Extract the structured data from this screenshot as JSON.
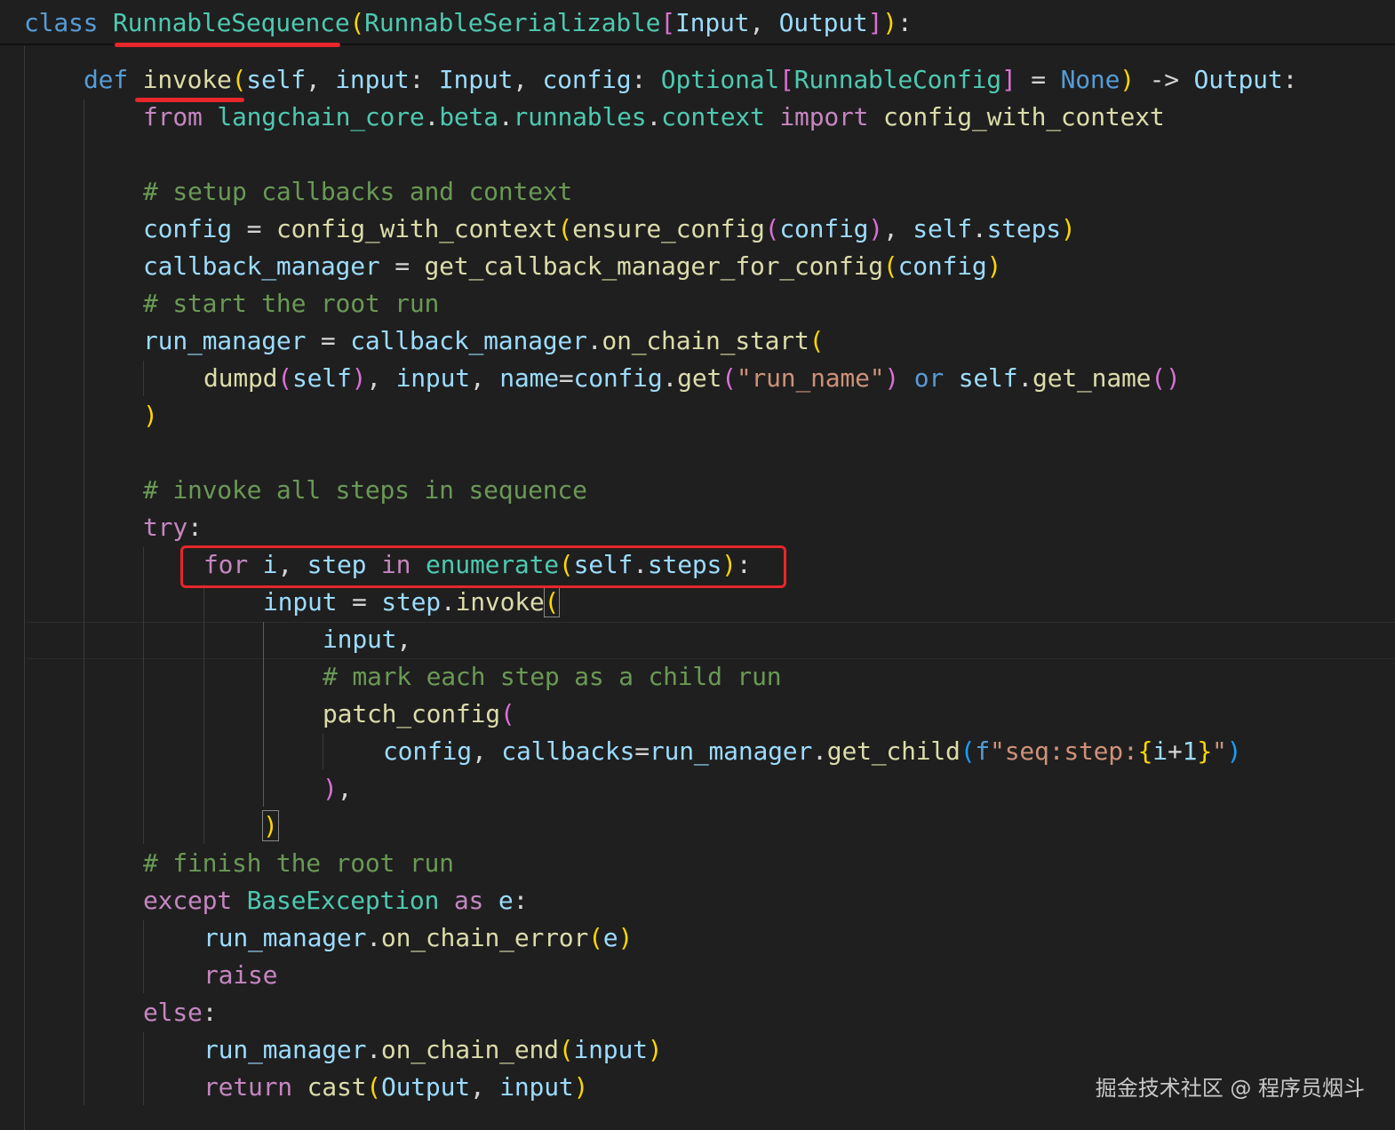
{
  "code": {
    "l1": {
      "a": "class",
      "b": "RunnableSequence",
      "c": "(",
      "d": "RunnableSerializable",
      "e": "[",
      "f": "Input",
      "g": ", ",
      "h": "Output",
      "i": "]",
      "j": ")",
      "k": ":"
    },
    "l2": {
      "a": "def",
      "b": "invoke",
      "c": "(",
      "d": "self",
      "e": ", ",
      "f": "input",
      "g": ": ",
      "h": "Input",
      "i": ", ",
      "j": "config",
      "k": ": ",
      "l": "Optional",
      "m": "[",
      "n": "RunnableConfig",
      "o": "]",
      "p": " = ",
      "q": "None",
      "r": ")",
      "s": " -> ",
      "t": "Output",
      "u": ":"
    },
    "l3": {
      "a": "from",
      "b": "langchain_core",
      "c": ".",
      "d": "beta",
      "e": ".",
      "f": "runnables",
      "g": ".",
      "h": "context",
      "i": "import",
      "j": "config_with_context"
    },
    "l4": {
      "a": "# setup callbacks and context"
    },
    "l5": {
      "a": "config",
      "b": " = ",
      "c": "config_with_context",
      "d": "(",
      "e": "ensure_config",
      "f": "(",
      "g": "config",
      "h": ")",
      "i": ", ",
      "j": "self",
      "k": ".",
      "l": "steps",
      "m": ")"
    },
    "l6": {
      "a": "callback_manager",
      "b": " = ",
      "c": "get_callback_manager_for_config",
      "d": "(",
      "e": "config",
      "f": ")"
    },
    "l7": {
      "a": "# start the root run"
    },
    "l8": {
      "a": "run_manager",
      "b": " = ",
      "c": "callback_manager",
      "d": ".",
      "e": "on_chain_start",
      "f": "("
    },
    "l9": {
      "a": "dumpd",
      "b": "(",
      "c": "self",
      "d": ")",
      "e": ", ",
      "f": "input",
      "g": ", ",
      "h": "name",
      "i": "=",
      "j": "config",
      "k": ".",
      "l": "get",
      "m": "(",
      "n": "\"run_name\"",
      "o": ")",
      "p": " or ",
      "q": "self",
      "r": ".",
      "s": "get_name",
      "t": "()"
    },
    "l10": {
      "a": ")"
    },
    "l11": {
      "a": "# invoke all steps in sequence"
    },
    "l12": {
      "a": "try",
      "b": ":"
    },
    "l13": {
      "a": "for",
      "b": "i",
      "c": ", ",
      "d": "step",
      "e": "in",
      "f": "enumerate",
      "g": "(",
      "h": "self",
      "i": ".",
      "j": "steps",
      "k": ")",
      "l": ":"
    },
    "l14": {
      "a": "input",
      "b": " = ",
      "c": "step",
      "d": ".",
      "e": "invoke",
      "f": "("
    },
    "l15": {
      "a": "input",
      "b": ","
    },
    "l16": {
      "a": "# mark each step as a child run"
    },
    "l17": {
      "a": "patch_config",
      "b": "("
    },
    "l18": {
      "a": "config",
      "b": ", ",
      "c": "callbacks",
      "d": "=",
      "e": "run_manager",
      "f": ".",
      "g": "get_child",
      "h": "(",
      "i": "f",
      "j": "\"seq:step:",
      "k": "{",
      "l": "i",
      "m": "+",
      "n": "1",
      "o": "}",
      "p": "\"",
      "q": ")"
    },
    "l19": {
      "a": ")",
      "b": ","
    },
    "l20": {
      "a": ")"
    },
    "l21": {
      "a": "# finish the root run"
    },
    "l22": {
      "a": "except",
      "b": "BaseException",
      "c": "as",
      "d": "e",
      "e": ":"
    },
    "l23": {
      "a": "run_manager",
      "b": ".",
      "c": "on_chain_error",
      "d": "(",
      "e": "e",
      "f": ")"
    },
    "l24": {
      "a": "raise"
    },
    "l25": {
      "a": "else",
      "b": ":"
    },
    "l26": {
      "a": "run_manager",
      "b": ".",
      "c": "on_chain_end",
      "d": "(",
      "e": "input",
      "f": ")"
    },
    "l27": {
      "a": "return",
      "b": "cast",
      "c": "(",
      "d": "Output",
      "e": ", ",
      "f": "input",
      "g": ")"
    }
  },
  "watermark": "掘金技术社区 @ 程序员烟斗",
  "colors": {
    "background": "#1f1f1f",
    "annotation_red": "#e8262b",
    "keyword": "#c586c0",
    "class": "#4ec9b0",
    "function": "#dcdcaa",
    "variable": "#9cdcfe",
    "comment": "#6a9955",
    "string": "#ce9178"
  }
}
